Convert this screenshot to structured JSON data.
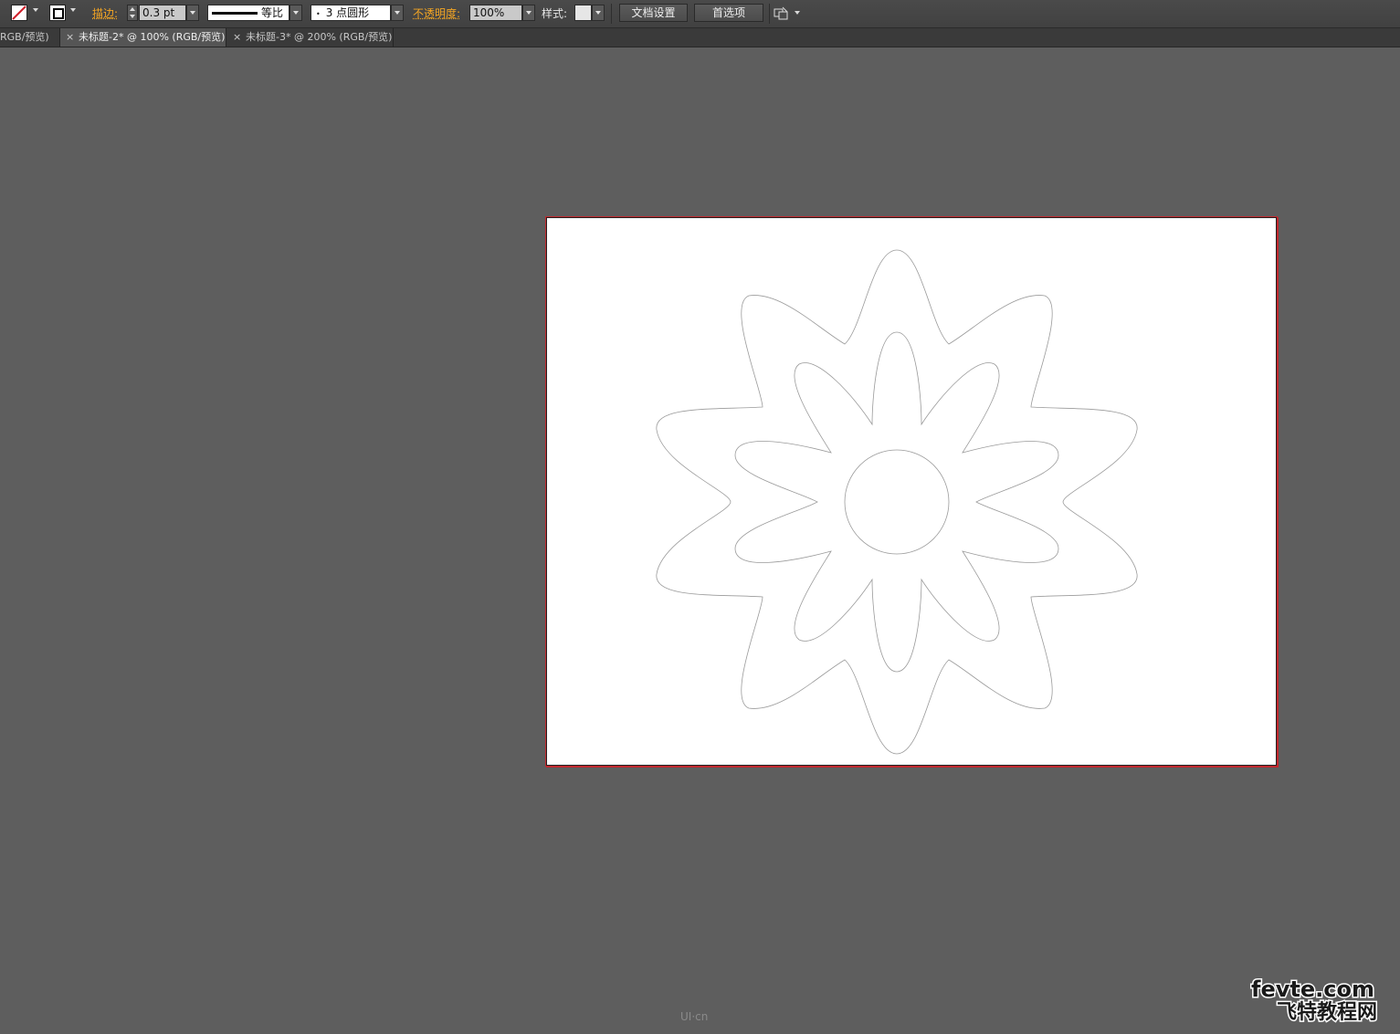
{
  "control_bar": {
    "fill_icon": "none-fill-swatch-icon",
    "stroke_icon": "stroke-swatch-icon",
    "stroke_label": "描边:",
    "stroke_value": "0.3 pt",
    "profile_label": "等比",
    "brush_label": "3 点圆形",
    "opacity_label": "不透明度:",
    "opacity_value": "100%",
    "style_label": "样式:",
    "doc_setup_button": "文档设置",
    "prefs_button": "首选项",
    "arrange_icon": "arrange-documents-icon"
  },
  "tabs": [
    {
      "label": "RGB/预览)",
      "close": ""
    },
    {
      "label": "未标题-2* @ 100% (RGB/预览)",
      "close": "×"
    },
    {
      "label": "未标题-3* @ 200% (RGB/预览)",
      "close": "×"
    }
  ],
  "watermarks": {
    "uicn": "UI·cn",
    "fevte_top": "fevte.com",
    "fevte_bottom": "飞特教程网"
  },
  "colors": {
    "workspace": "#5e5e5e",
    "artboard_border": "#c0272d",
    "accent_label": "#f5a623",
    "outline": "#9a9a9a"
  }
}
